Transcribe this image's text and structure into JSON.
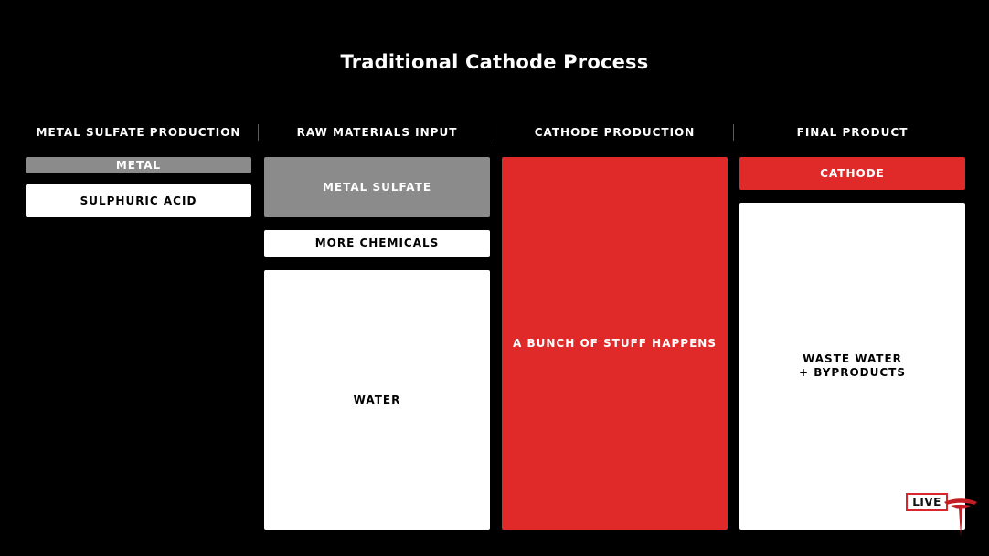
{
  "title": "Traditional Cathode Process",
  "columns": {
    "metal_sulfate_production": "METAL SULFATE PRODUCTION",
    "raw_materials_input": "RAW MATERIALS INPUT",
    "cathode_production": "CATHODE PRODUCTION",
    "final_product": "FINAL PRODUCT"
  },
  "boxes": {
    "metal": "METAL",
    "sulphuric_acid": "SULPHURIC ACID",
    "metal_sulfate": "METAL SULFATE",
    "more_chemicals": "MORE CHEMICALS",
    "water": "WATER",
    "a_bunch_of_stuff_happens": "A BUNCH OF STUFF HAPPENS",
    "cathode": "CATHODE",
    "waste_water_byproducts": "WASTE WATER\n+ BYPRODUCTS"
  },
  "overlay": {
    "live_label": "LIVE",
    "logo_icon": "tesla-logo-icon"
  },
  "colors": {
    "background": "#000000",
    "accent_red": "#e02a2a",
    "gray": "#8b8b8b",
    "white": "#ffffff"
  }
}
